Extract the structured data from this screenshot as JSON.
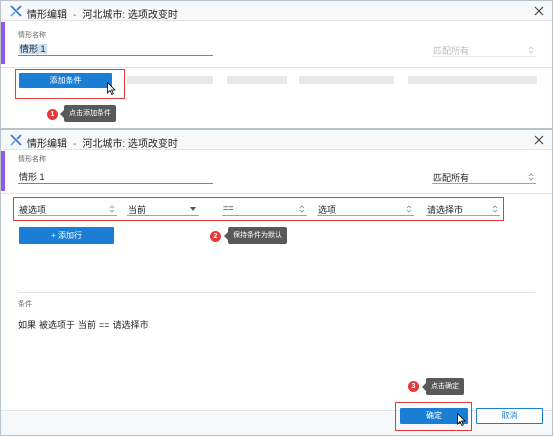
{
  "dialog_top": {
    "title_prefix": "情形编辑",
    "title_separator": "-",
    "title_context": "河北城市: 选项改变时",
    "name_label": "情形名称",
    "name_value": "情形 1",
    "match_placeholder": "匹配所有",
    "add_condition_label": "添加条件",
    "step1_badge": "1",
    "step1_tip": "点击添加条件"
  },
  "dialog_bottom": {
    "title_prefix": "情形编辑",
    "title_separator": "-",
    "title_context": "河北城市: 选项改变时",
    "name_label": "情形名称",
    "name_value": "情形 1",
    "match_value": "匹配所有",
    "condition_row": {
      "field": "被选项",
      "scope": "当前",
      "operator": "==",
      "value_type": "选项",
      "value": "请选择市"
    },
    "add_row_label": "+ 添加行",
    "step2_badge": "2",
    "step2_tip": "保持条件为默认",
    "conditions_label": "条件",
    "condition_text": {
      "if": "如果",
      "field": "被选项于",
      "scope": "当前",
      "operator": "==",
      "value": "请选择市"
    },
    "step3_badge": "3",
    "step3_tip": "点击确定",
    "confirm_label": "确定",
    "cancel_label": "取消"
  },
  "colors": {
    "accent": "#8c5ce6",
    "primary": "#1a7fd4",
    "highlight_red": "#e03a3a",
    "tooltip_bg": "#595959"
  }
}
